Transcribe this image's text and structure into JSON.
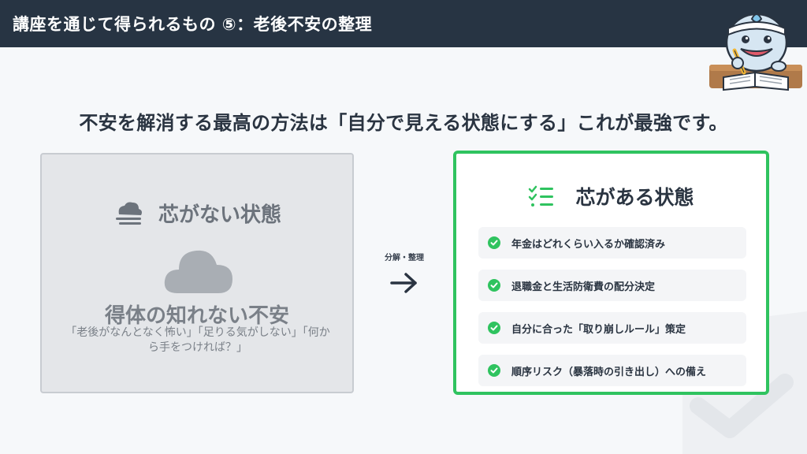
{
  "header": {
    "title": "講座を通じて得られるもの ⑤：老後不安の整理"
  },
  "headline": "不安を解消する最高の方法は「自分で見える状態にする」これが最強です。",
  "left_card": {
    "icon": "fog-cloud-icon",
    "title": "芯がない状態",
    "main_text": "得体の知れない不安",
    "sub_text": "「老後がなんとなく怖い」「足りる気がしない」「何から手をつければ？」"
  },
  "arrow": {
    "label": "分解・整理",
    "icon": "arrow-right-icon"
  },
  "right_card": {
    "icon": "checklist-icon",
    "title": "芯がある状態",
    "items": [
      {
        "label": "年金はどれくらい入るか確認済み"
      },
      {
        "label": "退職金と生活防衛費の配分決定"
      },
      {
        "label": "自分に合った「取り崩しルール」策定"
      },
      {
        "label": "順序リスク（暴落時の引き出し）への備え"
      }
    ]
  },
  "colors": {
    "header_bg": "#273443",
    "accent_green": "#2fc35f",
    "muted_gray": "#7a8088"
  }
}
